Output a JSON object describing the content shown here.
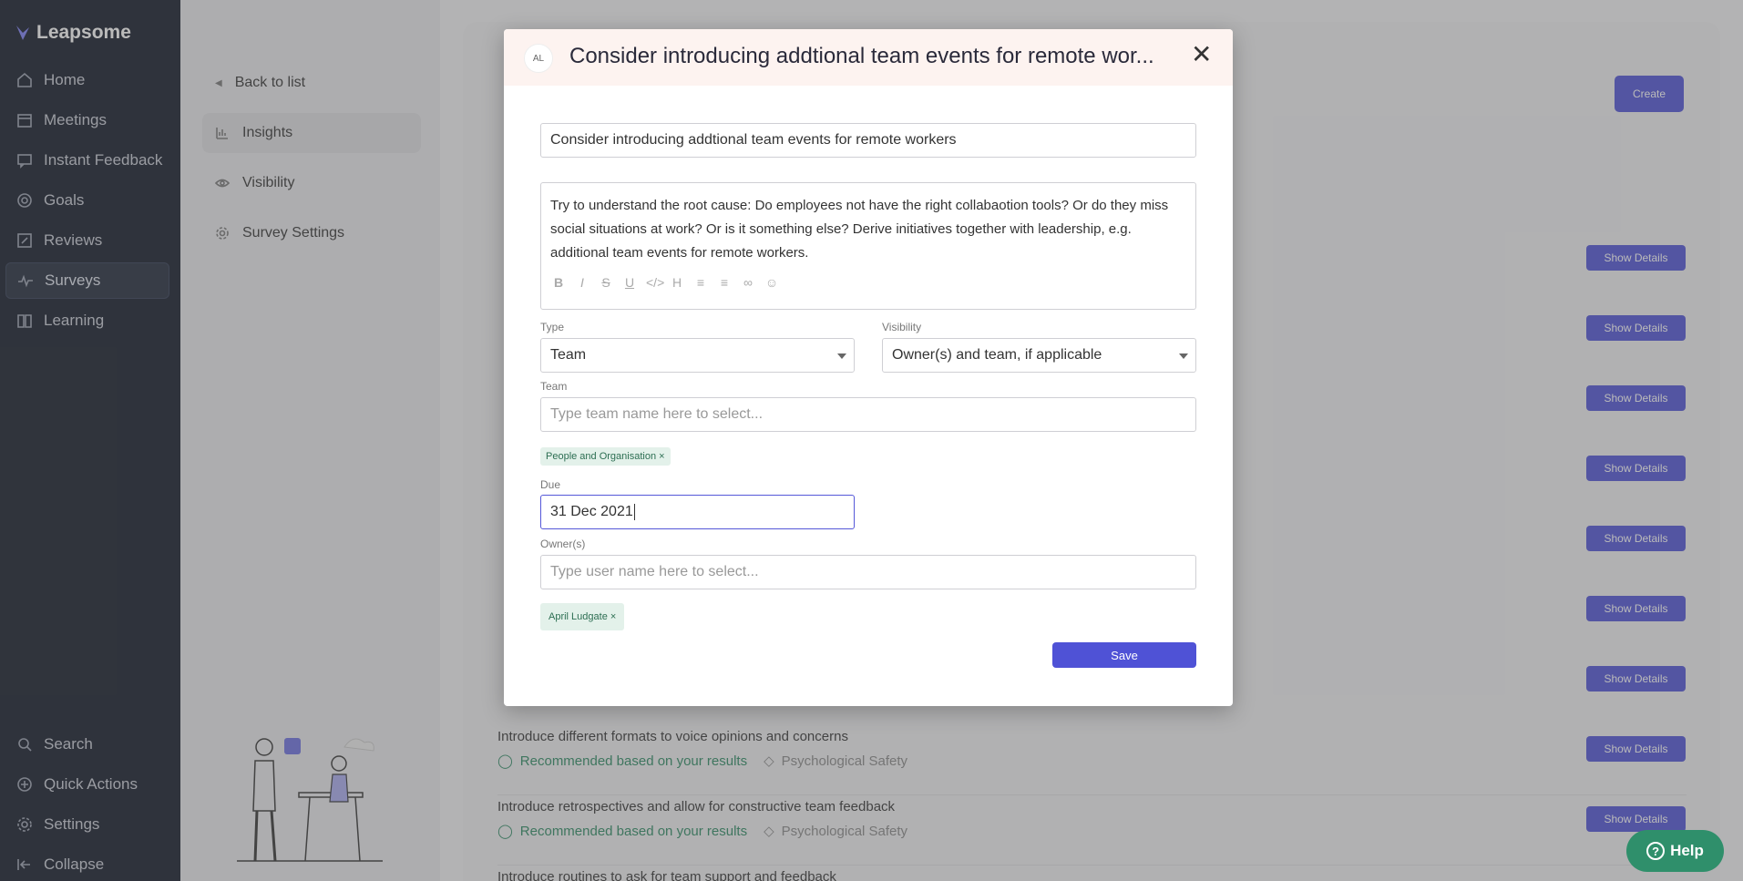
{
  "brand": {
    "name": "Leapsome"
  },
  "nav": {
    "items": [
      {
        "label": "Home",
        "icon": "home-icon"
      },
      {
        "label": "Meetings",
        "icon": "calendar-icon"
      },
      {
        "label": "Instant Feedback",
        "icon": "feedback-icon"
      },
      {
        "label": "Goals",
        "icon": "target-icon"
      },
      {
        "label": "Reviews",
        "icon": "edit-icon"
      },
      {
        "label": "Surveys",
        "icon": "pulse-icon",
        "active": true
      },
      {
        "label": "Learning",
        "icon": "book-icon"
      }
    ],
    "bottom": [
      {
        "label": "Search",
        "icon": "search-icon"
      },
      {
        "label": "Quick Actions",
        "icon": "plus-circle-icon"
      },
      {
        "label": "Settings",
        "icon": "gear-icon"
      },
      {
        "label": "Collapse",
        "icon": "collapse-icon"
      }
    ]
  },
  "subnav": {
    "back": "Back to list",
    "items": [
      {
        "label": "Insights",
        "icon": "chart-icon",
        "active": true
      },
      {
        "label": "Visibility",
        "icon": "eye-icon"
      },
      {
        "label": "Survey Settings",
        "icon": "gear-icon"
      }
    ]
  },
  "main": {
    "create_label": "Create",
    "show_details_label": "Show Details",
    "recommended_label": "Recommended based on your results",
    "rows": [
      {
        "title": "Introduce different formats to voice opinions and concerns",
        "tag": "Psychological Safety"
      },
      {
        "title": "Introduce retrospectives and allow for constructive team feedback",
        "tag": "Psychological Safety"
      },
      {
        "title": "Introduce routines to ask for team support and feedback",
        "tag": ""
      }
    ]
  },
  "modal": {
    "avatar": "AL",
    "title": "Consider introducing addtional team events for remote wor...",
    "name_value": "Consider introducing addtional team events for remote workers",
    "description": "Try to understand the root cause: Do employees not have the right collabaotion tools? Or do they miss social situations at work? Or is it something else? Derive initiatives together with leadership, e.g. additional team events for remote workers.",
    "type_label": "Type",
    "type_value": "Team",
    "visibility_label": "Visibility",
    "visibility_value": "Owner(s) and team, if applicable",
    "team_label": "Team",
    "team_placeholder": "Type team name here to select...",
    "team_chip": "People and Organisation",
    "due_label": "Due",
    "due_value": "31 Dec 2021",
    "owners_label": "Owner(s)",
    "owners_placeholder": "Type user name here to select...",
    "owner_chip": "April Ludgate",
    "save_label": "Save"
  },
  "help": {
    "label": "Help"
  }
}
